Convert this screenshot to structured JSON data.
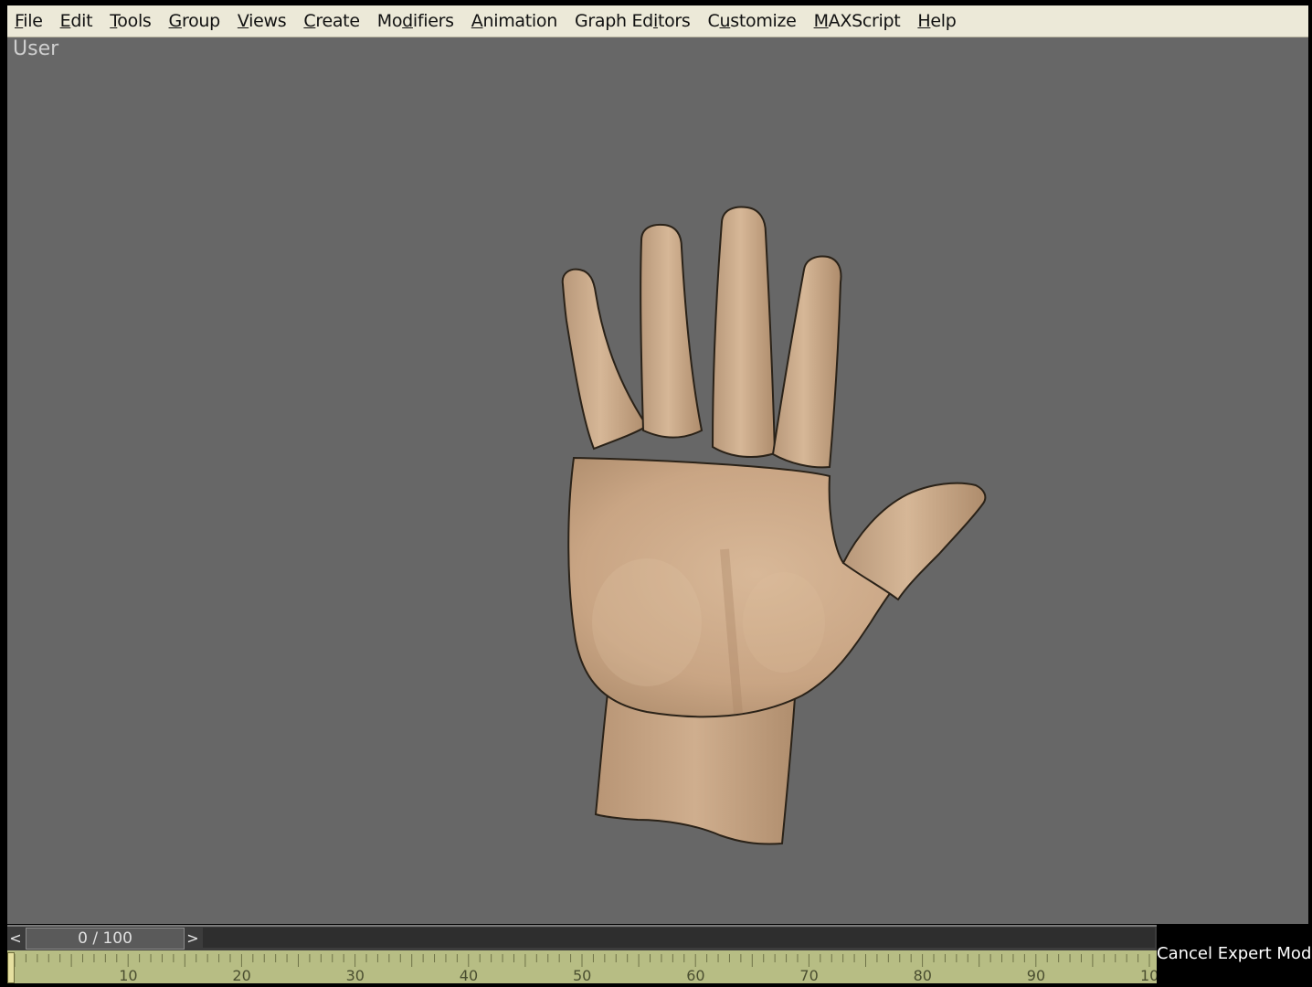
{
  "menubar": {
    "items": [
      {
        "pre": "",
        "u": "F",
        "post": "ile"
      },
      {
        "pre": "",
        "u": "E",
        "post": "dit"
      },
      {
        "pre": "",
        "u": "T",
        "post": "ools"
      },
      {
        "pre": "",
        "u": "G",
        "post": "roup"
      },
      {
        "pre": "",
        "u": "V",
        "post": "iews"
      },
      {
        "pre": "",
        "u": "C",
        "post": "reate"
      },
      {
        "pre": "Mo",
        "u": "d",
        "post": "ifiers"
      },
      {
        "pre": "",
        "u": "A",
        "post": "nimation"
      },
      {
        "pre": "Graph Ed",
        "u": "i",
        "post": "tors"
      },
      {
        "pre": "C",
        "u": "u",
        "post": "stomize"
      },
      {
        "pre": "",
        "u": "M",
        "post": "AXScript"
      },
      {
        "pre": "",
        "u": "H",
        "post": "elp"
      }
    ]
  },
  "viewport": {
    "label": "User",
    "background": "#676767",
    "skin_color": "#c8a585"
  },
  "timeslider": {
    "prev_icon": "<",
    "next_icon": ">",
    "frame_text": "0 / 100",
    "current_frame": 0,
    "total_frames": 100
  },
  "status": {
    "cancel_expert_mode": "Cancel Expert Mode"
  },
  "trackbar": {
    "labels": [
      "10",
      "20",
      "30",
      "40",
      "50",
      "60",
      "70",
      "80",
      "90",
      "10"
    ],
    "color": "#b7bd84"
  }
}
